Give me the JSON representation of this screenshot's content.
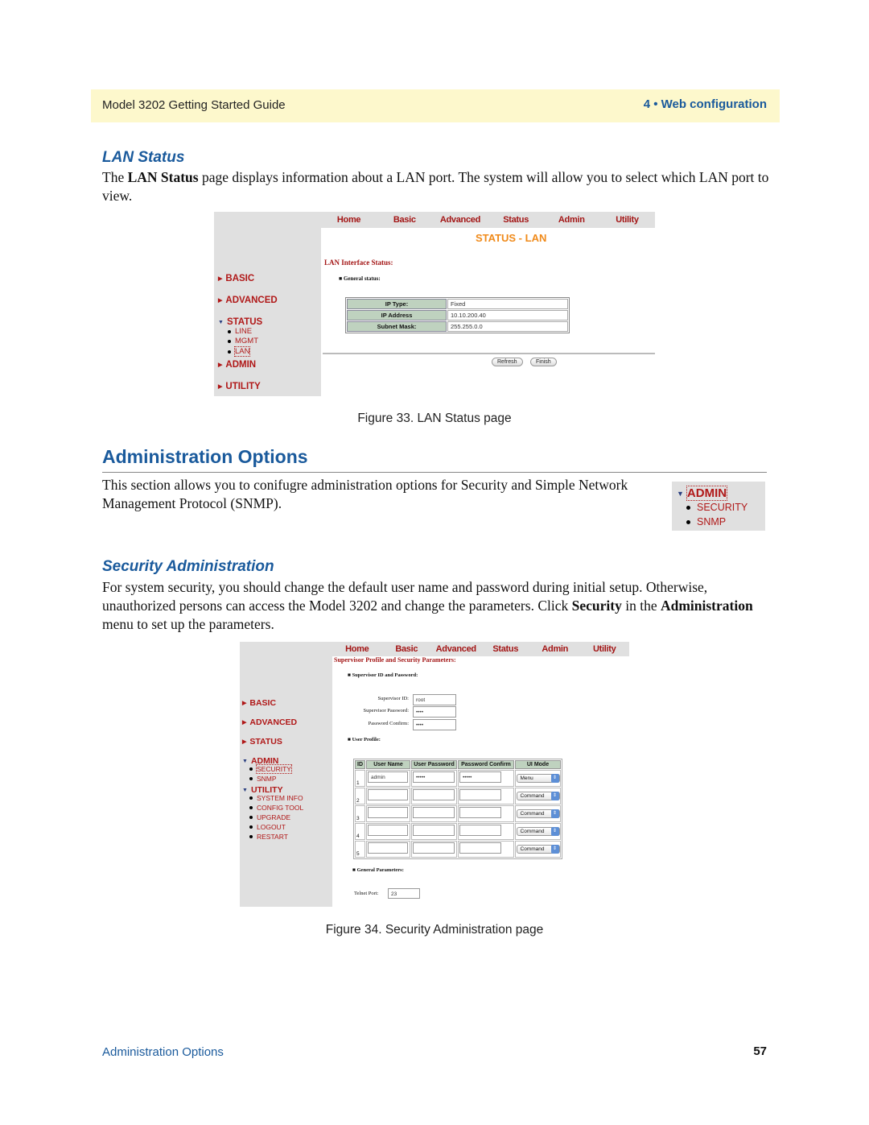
{
  "header": {
    "title": "Model 3202 Getting Started Guide",
    "chapter": "4 • Web configuration"
  },
  "lan_status": {
    "heading": "LAN Status",
    "para_pre": "The ",
    "para_bold": "LAN Status",
    "para_post": " page displays information about a LAN port. The system will allow you to select which LAN port to view.",
    "figure": {
      "nav": [
        "Home",
        "Basic",
        "Advanced",
        "Status",
        "Admin",
        "Utility"
      ],
      "page_title": "STATUS - LAN",
      "section_title": "LAN Interface Status:",
      "bullet": "General status:",
      "rows": [
        {
          "label": "IP Type:",
          "value": "Fixed"
        },
        {
          "label": "IP Address",
          "value": "10.10.200.40"
        },
        {
          "label": "Subnet Mask:",
          "value": "255.255.0.0"
        }
      ],
      "buttons": {
        "refresh": "Refresh",
        "finish": "Finish"
      },
      "menu": {
        "basic": "BASIC",
        "advanced": "ADVANCED",
        "status": "STATUS",
        "status_sub": [
          "LINE",
          "MGMT",
          "LAN"
        ],
        "admin": "ADMIN",
        "utility": "UTILITY"
      }
    },
    "caption": "Figure 33. LAN Status page"
  },
  "admin_options": {
    "heading": "Administration Options",
    "para": "This section allows you to conifugre administration options for Security and Simple Network Management Protocol (SNMP).",
    "menu_snippet": {
      "admin": "ADMIN",
      "items": [
        "SECURITY",
        "SNMP"
      ]
    }
  },
  "security_admin": {
    "heading": "Security Administration",
    "para_1": "For system security, you should change the default user name and password during initial setup. Otherwise, unauthorized persons can access the Model 3202 and change the parameters. Click ",
    "para_bold_1": "Security",
    "para_2": " in the ",
    "para_bold_2": "Administration",
    "para_3": " menu to set up the parameters.",
    "figure": {
      "nav": [
        "Home",
        "Basic",
        "Advanced",
        "Status",
        "Admin",
        "Utility"
      ],
      "page_title": "Supervisor Profile and Security Parameters:",
      "bullet_1": "Supervisor ID and Password:",
      "supervisor_id_label": "Supervisor ID:",
      "supervisor_id": "root",
      "supervisor_password_label": "Supervisor Password:",
      "supervisor_password": "••••",
      "password_confirm_label": "Password Confirm:",
      "password_confirm": "••••",
      "bullet_2": "User Profile:",
      "columns": [
        "ID",
        "User Name",
        "User Password",
        "Password Confirm",
        "UI Mode"
      ],
      "users": [
        {
          "id": "1",
          "name": "admin",
          "password": "•••••",
          "confirm": "•••••",
          "mode": "Menu"
        },
        {
          "id": "2",
          "name": "",
          "password": "",
          "confirm": "",
          "mode": "Command"
        },
        {
          "id": "3",
          "name": "",
          "password": "",
          "confirm": "",
          "mode": "Command"
        },
        {
          "id": "4",
          "name": "",
          "password": "",
          "confirm": "",
          "mode": "Command"
        },
        {
          "id": "5",
          "name": "",
          "password": "",
          "confirm": "",
          "mode": "Command"
        }
      ],
      "bullet_3": "General Parameters:",
      "telnet_label": "Telnet Port:",
      "telnet_port": "23",
      "menu": {
        "basic": "BASIC",
        "advanced": "ADVANCED",
        "status": "STATUS",
        "admin": "ADMIN",
        "admin_sub": [
          "SECURITY",
          "SNMP"
        ],
        "utility": "UTILITY",
        "utility_sub": [
          "SYSTEM INFO",
          "CONFIG TOOL",
          "UPGRADE",
          "LOGOUT",
          "RESTART"
        ]
      }
    },
    "caption": "Figure 34. Security Administration page"
  },
  "footer": {
    "section": "Administration Options",
    "page": "57"
  }
}
